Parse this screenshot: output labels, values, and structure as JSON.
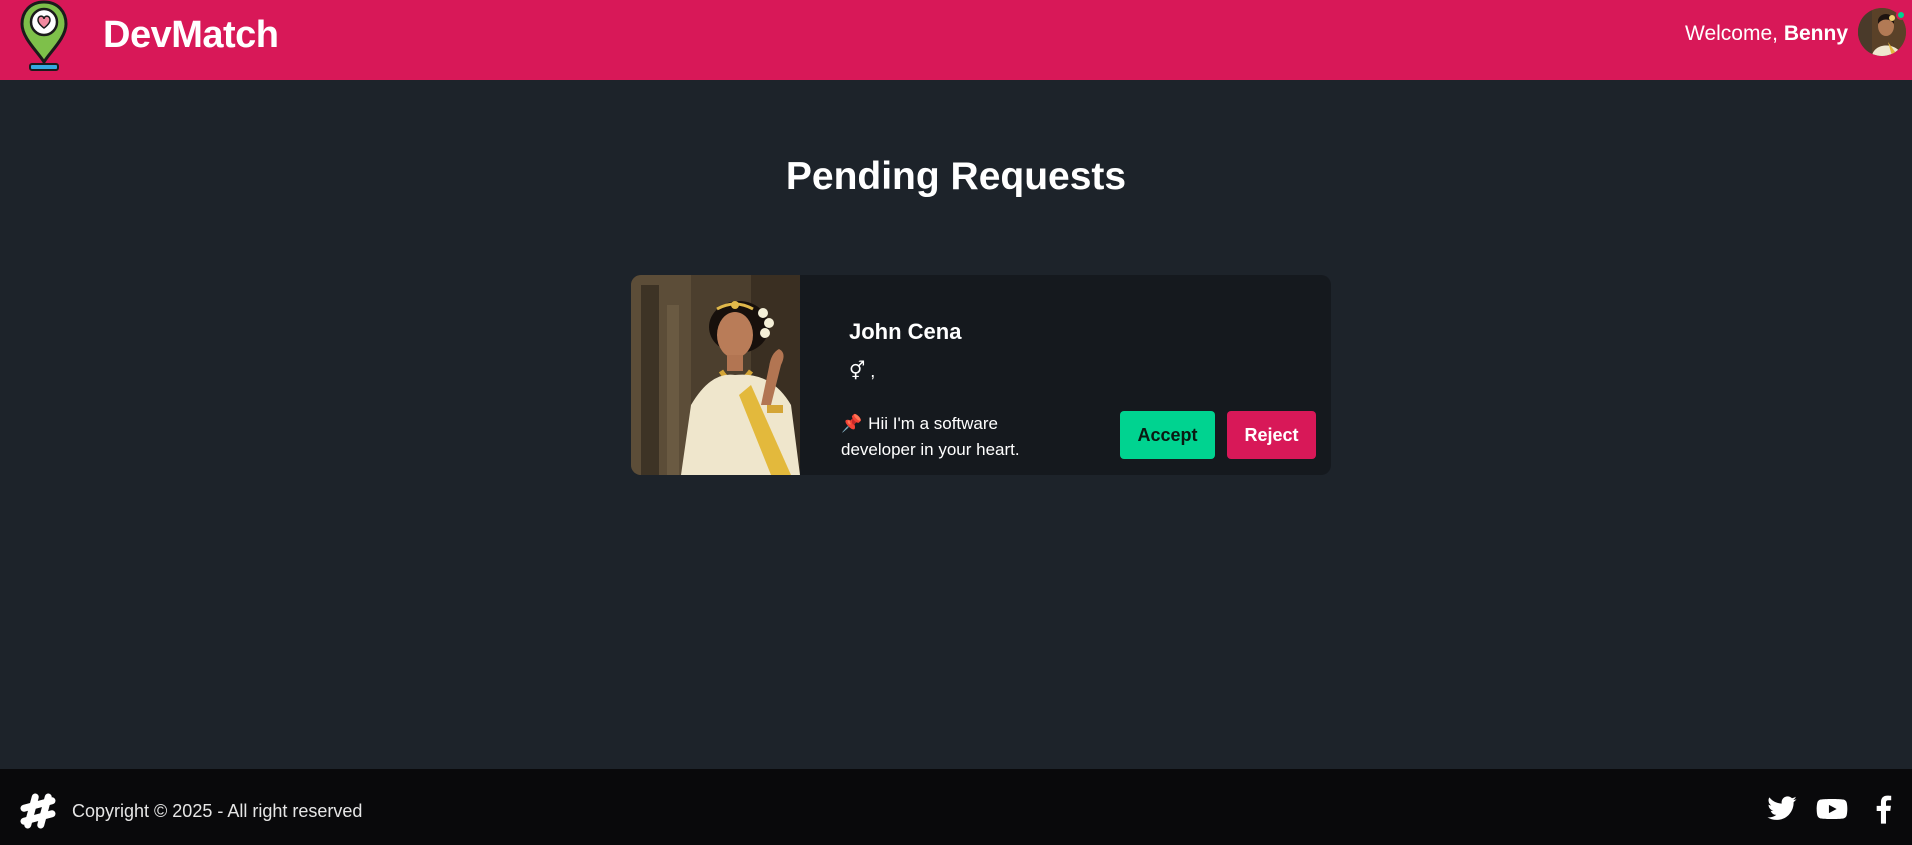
{
  "navbar": {
    "brand": "DevMatch",
    "welcome_prefix": "Welcome, ",
    "user_name": "Benny",
    "colors": {
      "primary": "#d81858"
    }
  },
  "main": {
    "title": "Pending Requests",
    "requests": [
      {
        "name": "John Cena",
        "gender_line": "⚥ ,",
        "about": "Hii I'm a software developer in your heart.",
        "pin_icon": "📌",
        "accept_label": "Accept",
        "reject_label": "Reject"
      }
    ]
  },
  "footer": {
    "copyright": "Copyright © 2025 - All right reserved",
    "social_icons": [
      "twitter-icon",
      "youtube-icon",
      "facebook-icon"
    ]
  },
  "colors": {
    "background": "#1d232a",
    "card": "#15191e",
    "accept": "#00d390",
    "reject": "#d81858",
    "footer": "#09090b"
  }
}
